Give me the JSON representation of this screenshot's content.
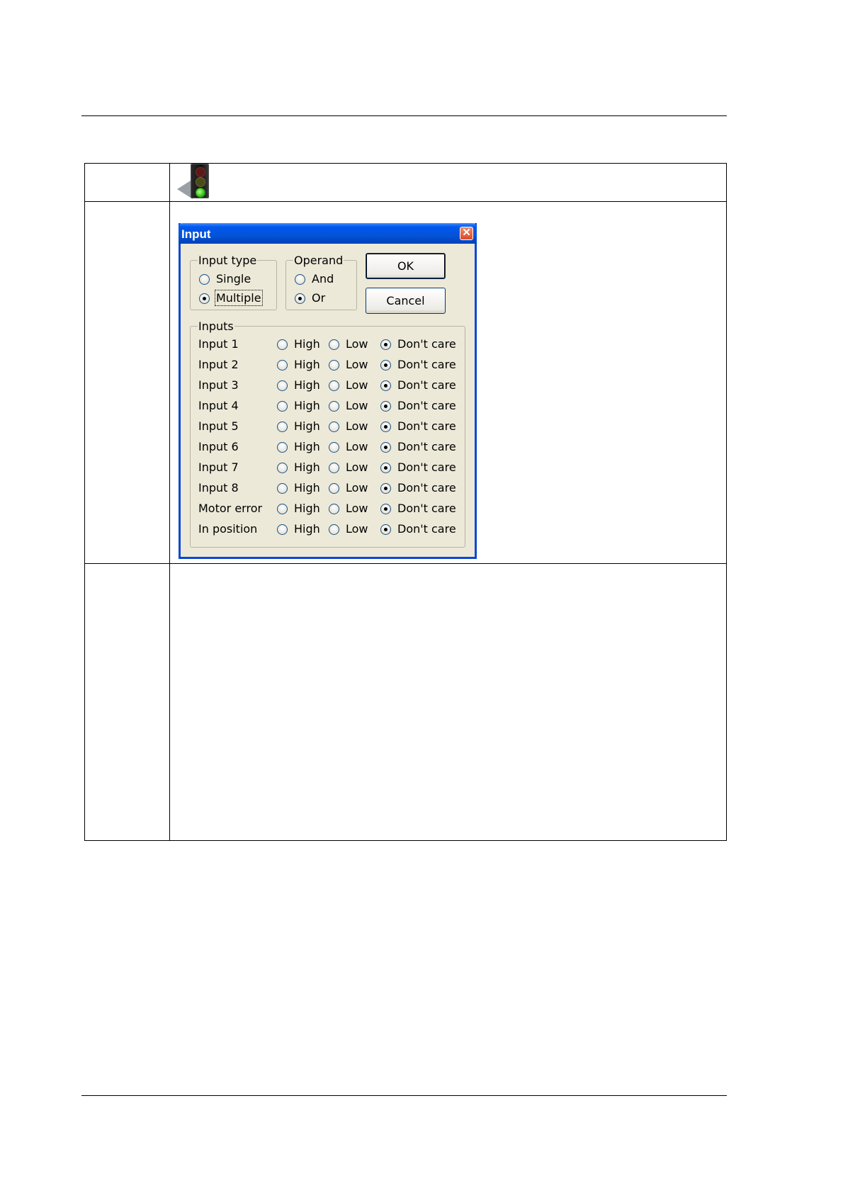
{
  "dialog": {
    "title": "Input",
    "close_symbol": "✕",
    "input_type": {
      "label": "Input type",
      "options": [
        "Single",
        "Multiple"
      ],
      "selected": "Multiple"
    },
    "operand": {
      "label": "Operand",
      "options": [
        "And",
        "Or"
      ],
      "selected": "Or"
    },
    "ok_label": "OK",
    "cancel_label": "Cancel",
    "inputs": {
      "label": "Inputs",
      "state_labels": [
        "High",
        "Low",
        "Don't care"
      ],
      "rows": [
        {
          "name": "Input 1",
          "selected": "Don't care"
        },
        {
          "name": "Input 2",
          "selected": "Don't care"
        },
        {
          "name": "Input 3",
          "selected": "Don't care"
        },
        {
          "name": "Input 4",
          "selected": "Don't care"
        },
        {
          "name": "Input 5",
          "selected": "Don't care"
        },
        {
          "name": "Input 6",
          "selected": "Don't care"
        },
        {
          "name": "Input 7",
          "selected": "Don't care"
        },
        {
          "name": "Input 8",
          "selected": "Don't care"
        },
        {
          "name": "Motor error",
          "selected": "Don't care"
        },
        {
          "name": "In position",
          "selected": "Don't care"
        }
      ]
    }
  },
  "icons": {
    "toolbar_icon": "traffic-light-icon"
  },
  "colors": {
    "titlebar": "#0453d8",
    "dialog_bg": "#ece9d8",
    "close_button": "#d84a28"
  }
}
